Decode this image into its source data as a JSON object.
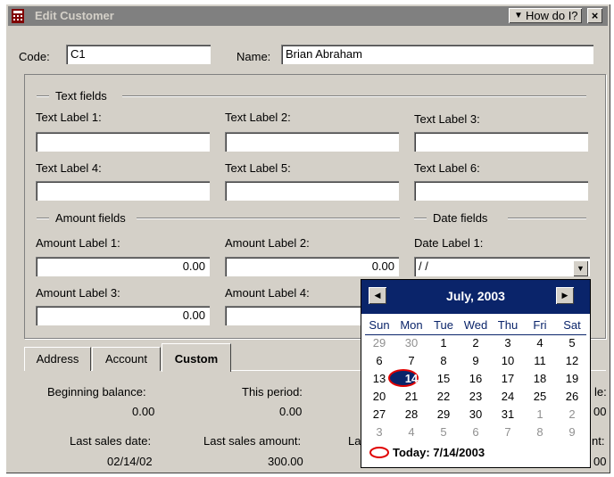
{
  "window": {
    "title": "Edit Customer",
    "help_label": "How do I?",
    "close_label": "×"
  },
  "header": {
    "code_label": "Code:",
    "code_value": "C1",
    "name_label": "Name:",
    "name_value": "Brian Abraham"
  },
  "sections": {
    "text_fields": "Text fields",
    "amount_fields": "Amount fields",
    "date_fields": "Date fields"
  },
  "text_labels": [
    "Text Label 1:",
    "Text Label 2:",
    "Text Label 3:",
    "Text Label 4:",
    "Text Label 5:",
    "Text Label 6:"
  ],
  "amount_labels": [
    "Amount Label 1:",
    "Amount Label 2:",
    "Amount Label 3:",
    "Amount Label 4:"
  ],
  "amount_values": [
    "0.00",
    "0.00",
    "0.00",
    ""
  ],
  "date": {
    "label": "Date Label 1:",
    "value": " /  /"
  },
  "tabs": [
    {
      "label": "Address"
    },
    {
      "label": "Account"
    },
    {
      "label": "Custom",
      "active": true
    }
  ],
  "summary": {
    "beginning_balance_label": "Beginning balance:",
    "beginning_balance_value": "0.00",
    "this_period_label": "This period:",
    "this_period_value": "0.00",
    "third_label_fragment": "le:",
    "third_value_fragment": "00",
    "last_sales_date_label": "Last sales date:",
    "last_sales_date_value": "02/14/02",
    "last_sales_amount_label": "Last sales amount:",
    "last_sales_amount_value": "300.00",
    "cut_label_fragment": "La",
    "fourth_label_fragment": "nt:",
    "fourth_value_fragment": "00"
  },
  "calendar": {
    "month_label": "July, 2003",
    "prev_icon": "left-triangle-icon",
    "next_icon": "right-triangle-icon",
    "weekdays": [
      "Sun",
      "Mon",
      "Tue",
      "Wed",
      "Thu",
      "Fri",
      "Sat"
    ],
    "weeks": [
      [
        "29",
        "30",
        "1",
        "2",
        "3",
        "4",
        "5"
      ],
      [
        "6",
        "7",
        "8",
        "9",
        "10",
        "11",
        "12"
      ],
      [
        "13",
        "14",
        "15",
        "16",
        "17",
        "18",
        "19"
      ],
      [
        "20",
        "21",
        "22",
        "23",
        "24",
        "25",
        "26"
      ],
      [
        "27",
        "28",
        "29",
        "30",
        "31",
        "1",
        "2"
      ],
      [
        "3",
        "4",
        "5",
        "6",
        "7",
        "8",
        "9"
      ]
    ],
    "other_month_cells": [
      "0-0",
      "0-1",
      "4-5",
      "4-6",
      "5-0",
      "5-1",
      "5-2",
      "5-3",
      "5-4",
      "5-5",
      "5-6"
    ],
    "selected_day": "14",
    "today_label": "Today: 7/14/2003"
  },
  "colors": {
    "selection": "#0a246a",
    "today_ring": "#e00000",
    "face": "#d4d0c8"
  }
}
